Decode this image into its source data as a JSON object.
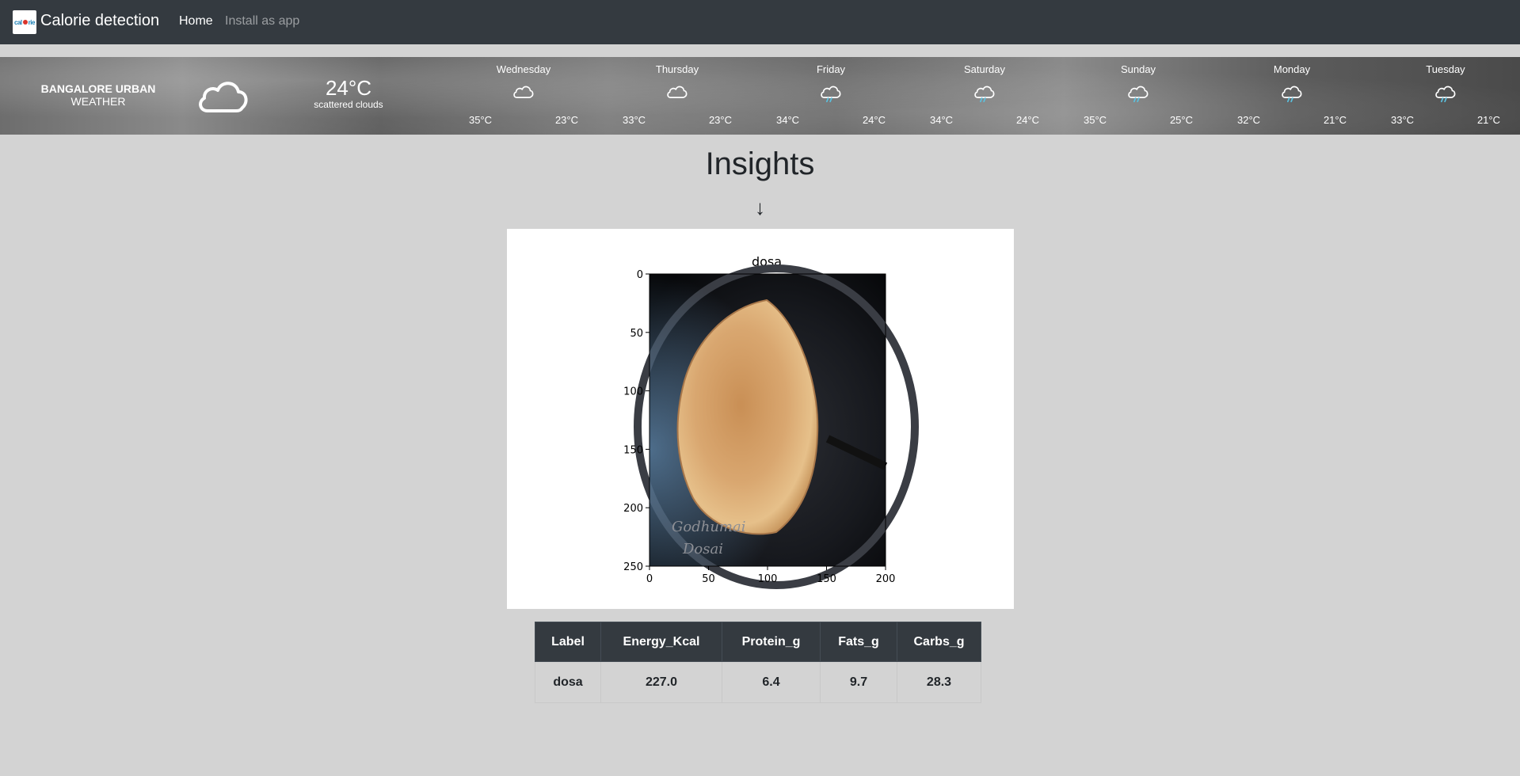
{
  "navbar": {
    "brand_logo_text": "calorie",
    "brand": "Calorie detection",
    "links": [
      {
        "label": "Home",
        "active": true
      },
      {
        "label": "Install as app",
        "active": false
      }
    ]
  },
  "weather": {
    "city": "BANGALORE URBAN",
    "label": "WEATHER",
    "current": {
      "icon": "cloud-icon",
      "temp": "24°C",
      "desc": "scattered clouds"
    },
    "days": [
      {
        "day": "Wednesday",
        "icon": "cloud-icon",
        "hi": "35°C",
        "lo": "23°C"
      },
      {
        "day": "Thursday",
        "icon": "cloud-icon",
        "hi": "33°C",
        "lo": "23°C"
      },
      {
        "day": "Friday",
        "icon": "rain-cloud-icon",
        "hi": "34°C",
        "lo": "24°C"
      },
      {
        "day": "Saturday",
        "icon": "rain-cloud-icon",
        "hi": "34°C",
        "lo": "24°C"
      },
      {
        "day": "Sunday",
        "icon": "rain-cloud-icon",
        "hi": "35°C",
        "lo": "25°C"
      },
      {
        "day": "Monday",
        "icon": "rain-cloud-icon",
        "hi": "32°C",
        "lo": "21°C"
      },
      {
        "day": "Tuesday",
        "icon": "rain-cloud-icon",
        "hi": "33°C",
        "lo": "21°C"
      }
    ]
  },
  "insights": {
    "title": "Insights",
    "arrow": "↓"
  },
  "chart_data": {
    "type": "image",
    "title": "dosa",
    "image_text": [
      "Godhumai",
      "Dosai"
    ],
    "xlim": [
      0,
      200
    ],
    "ylim": [
      250,
      0
    ],
    "xticks": [
      "0",
      "50",
      "100",
      "150",
      "200"
    ],
    "yticks": [
      "0",
      "50",
      "100",
      "150",
      "200",
      "250"
    ]
  },
  "table": {
    "headers": [
      "Label",
      "Energy_Kcal",
      "Protein_g",
      "Fats_g",
      "Carbs_g"
    ],
    "rows": [
      [
        "dosa",
        "227.0",
        "6.4",
        "9.7",
        "28.3"
      ]
    ]
  },
  "colors": {
    "navbar": "#343a40",
    "page_bg": "#d3d3d3",
    "rain_drop": "#5bc0de"
  }
}
